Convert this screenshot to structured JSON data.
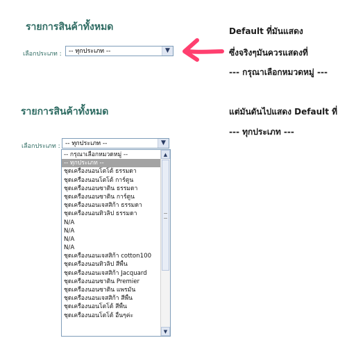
{
  "top": {
    "title": "รายการสินค้าทั้งหมด",
    "category_label": "เลือกประเภท :",
    "select_value": "-- ทุกประเภท --"
  },
  "annotation": {
    "line1": "Default ที่มันแสดง",
    "line2": "ซึ่งจริงๆมันควรแสดงที่",
    "line3": "--- กรุณาเลือกหมวดหมู่ ---",
    "line4": "แต่มันดันไปแสดง Default ที่",
    "line5": "--- ทุกประเภท ---",
    "arrow_color": "#ff3f6f"
  },
  "bottom": {
    "title": "รายการสินค้าทั้งหมด",
    "category_label": "เลือกประเภท :",
    "select_value": "-- ทุกประเภท --",
    "options": [
      "-- กรุณาเลือกหมวดหมู่ --",
      "-- ทุกประเภท --",
      "ชุดเครื่องนอนโตโต้ ธรรมดา",
      "ชุดเครื่องนอนโตโต้ การ์ตูน",
      "ชุดเครื่องนอนซาติน ธรรมดา",
      "ชุดเครื่องนอนซาติน การ์ตูน",
      "ชุดเครื่องนอนเจสสิก้า ธรรมดา",
      "ชุดเครื่องนอนทิวลิป ธรรมดา",
      "N/A",
      "N/A",
      "N/A",
      "N/A",
      "ชุดเครื่องนอนเจสสิก้า cotton100",
      "ชุดเครื่องนอนทิวลิป สีพื้น",
      "ชุดเครื่องนอนเจสสิก้า Jacquard",
      "ชุดเครื่องนอนซาติน Premier",
      "ชุดเครื่องนอนซาติน แพรมัน",
      "ชุดเครื่องนอนเจสสิก้า สีพื้น",
      "ชุดเครื่องนอนโตโต้ สีพื้น",
      "ชุดเครื่องนอนโตโต้ อื่นๆค่ะ"
    ],
    "selected_index": 1
  }
}
